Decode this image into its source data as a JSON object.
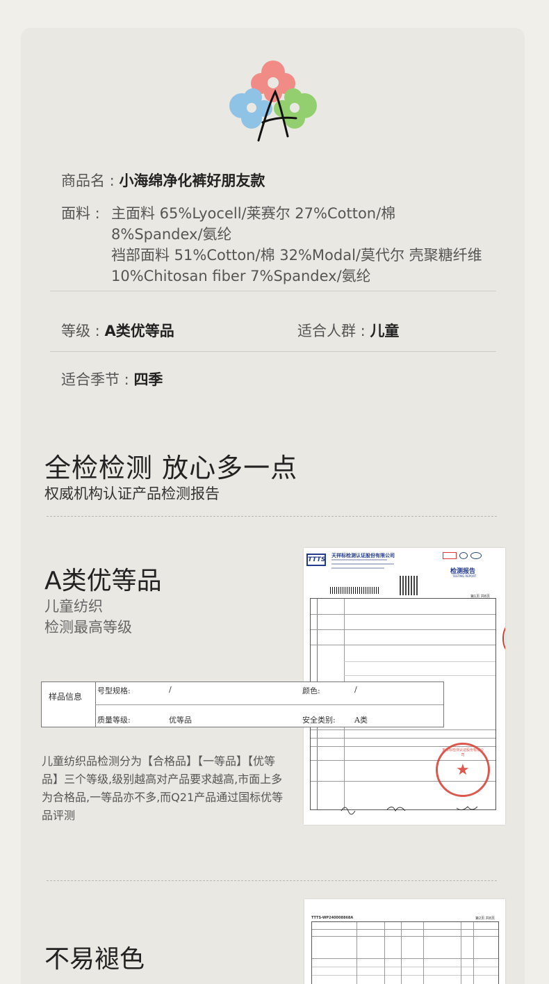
{
  "product": {
    "name_label": "商品名 : ",
    "name_value": "小海绵净化裤好朋友款",
    "fabric_label": "面料 : ",
    "fabric_line1": "主面料 65%Lyocell/莱赛尔  27%Cotton/棉",
    "fabric_line2": "8%Spandex/氨纶",
    "fabric_line3": "裆部面料 51%Cotton/棉 32%Modal/莫代尔 壳聚糖纤维",
    "fabric_line4": "10%Chitosan fiber 7%Spandex/氨纶",
    "grade_label": "等级 : ",
    "grade_value": "A类优等品",
    "audience_label": "适合人群 : ",
    "audience_value": "儿童",
    "season_label": "适合季节 : ",
    "season_value": "四季"
  },
  "inspection": {
    "title": "全检检测 放心多一点",
    "subtitle": "权威机构认证产品检测报告"
  },
  "grade_section": {
    "title": "A类优等品",
    "sub1": "儿童纺织",
    "sub2": "检测最高等级",
    "description": "儿童纺织品检测分为【合格品】【一等品】【优等品】三个等级,级别越高对产品要求越高,市面上多为合格品,一等品亦不多,而Q21产品通过国标优等品评测"
  },
  "sample_table": {
    "header": "样品信息",
    "model_label": "号型规格:",
    "model_value": "/",
    "color_label": "颜色:",
    "color_value": "/",
    "quality_label": "质量等级:",
    "quality_value": "优等品",
    "safety_label": "安全类别:",
    "safety_value": "A类"
  },
  "report1": {
    "company": "天祥标检测认证股份有限公司",
    "logo_text": "TTTS",
    "report_title": "检测报告",
    "report_title_en": "TESTING REPORT",
    "page": "第1页 共8页",
    "seal_text": "天祥标检测认证股份有限公司"
  },
  "report2": {
    "report_no": "TTTS-WP240008868A",
    "page": "第2页 共8页"
  },
  "fade_section": {
    "title": "不易褪色"
  },
  "colors": {
    "page_bg": "#f1efe9",
    "card_bg": "#e9e8e2",
    "logo_red": "#f08b86",
    "logo_blue": "#8fc3e6",
    "logo_green": "#93cf6e",
    "seal_red": "#d63a2f"
  }
}
